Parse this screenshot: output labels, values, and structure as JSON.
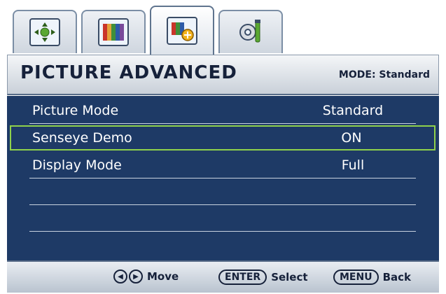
{
  "tabs": [
    {
      "icon": "move-arrows-icon",
      "active": false
    },
    {
      "icon": "color-bars-icon",
      "active": false
    },
    {
      "icon": "picture-advanced-icon",
      "active": true
    },
    {
      "icon": "settings-wrench-icon",
      "active": false
    }
  ],
  "header": {
    "title": "PICTURE ADVANCED",
    "mode": "MODE: Standard"
  },
  "menu": {
    "items": [
      {
        "label": "Picture Mode",
        "value": "Standard"
      },
      {
        "label": "Senseye Demo",
        "value": "ON",
        "selected": true
      },
      {
        "label": "Display Mode",
        "value": "Full"
      }
    ]
  },
  "footer": {
    "move_label": "Move",
    "enter_key": "ENTER",
    "select_label": "Select",
    "menu_key": "MENU",
    "back_label": "Back"
  },
  "colors": {
    "background": "#1e3a66",
    "selection_border": "#8fd14b",
    "text": "#ffffff"
  }
}
